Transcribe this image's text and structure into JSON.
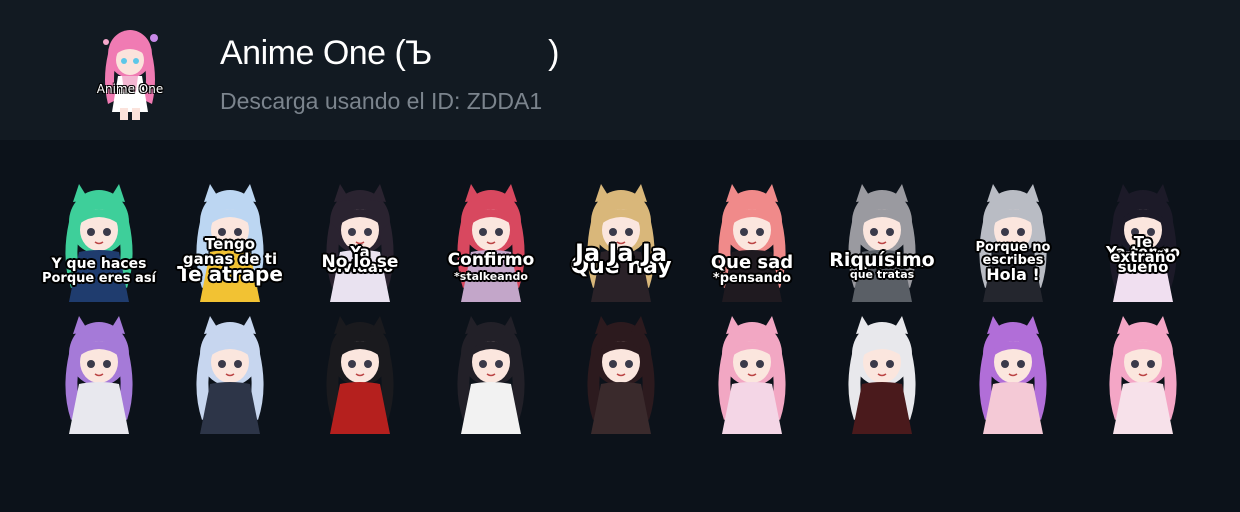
{
  "header": {
    "title": "Anime One (Ъ             )",
    "subtitle": "Descarga usando el ID: ZDDA1",
    "icon_caption": "Anime One"
  },
  "stickers": [
    {
      "caption": "Porque eres así",
      "hair": "#3ecf9a",
      "cloth": "#1f3c6e",
      "size": 13
    },
    {
      "caption": "Te atrape",
      "hair": "#bcd6f2",
      "cloth": "#f2c233",
      "size": 20
    },
    {
      "caption": "Ya\nolvidalo",
      "hair": "#2a2330",
      "cloth": "#e9e2f0",
      "size": 15
    },
    {
      "caption": "*stalkeando",
      "hair": "#d8485f",
      "cloth": "#c3a6c9",
      "size": 11
    },
    {
      "caption": "Que hay",
      "hair": "#d9b77a",
      "cloth": "#2a2228",
      "size": 22
    },
    {
      "caption": "*pensando",
      "hair": "#f08a8a",
      "cloth": "#1f1a20",
      "size": 13
    },
    {
      "caption": "Con quien crees\nque tratas",
      "hair": "#9a9aa0",
      "cloth": "#5a5f66",
      "size": 11
    },
    {
      "caption": "Hola !",
      "hair": "#b9bcc4",
      "cloth": "#24262e",
      "size": 16
    },
    {
      "caption": "Ya tengo\nsueño",
      "hair": "#1c1a28",
      "cloth": "#f0dff0",
      "size": 15
    },
    {
      "caption": "Y que haces",
      "hair": "#a57ad8",
      "cloth": "#e8e8ee",
      "size": 14
    },
    {
      "caption": "Tengo\nganas de ti",
      "hair": "#c7d6ef",
      "cloth": "#2d3548",
      "size": 15
    },
    {
      "caption": "No lo se",
      "hair": "#1a1a1e",
      "cloth": "#b5201e",
      "size": 17
    },
    {
      "caption": "Confirmo",
      "hair": "#222028",
      "cloth": "#f2f2f2",
      "size": 17
    },
    {
      "caption": "Ja Ja Ja",
      "hair": "#2c1a1e",
      "cloth": "#3a2a2c",
      "size": 24
    },
    {
      "caption": "Que sad",
      "hair": "#f2a7c3",
      "cloth": "#f4d6e6",
      "size": 18
    },
    {
      "caption": "Riquísimo",
      "hair": "#e8e8ec",
      "cloth": "#4a1a1c",
      "size": 19
    },
    {
      "caption": "Porque no\nescribes",
      "hair": "#b16ed8",
      "cloth": "#f4c9d6",
      "size": 13
    },
    {
      "caption": "Te\nextraño",
      "hair": "#f4a6c6",
      "cloth": "#f7e1ea",
      "size": 15
    }
  ],
  "colors": {
    "header_bg": "#121a22",
    "page_bg": "#0c121a",
    "subtitle": "#7b848d",
    "icon_hair": "#f07bb3"
  }
}
